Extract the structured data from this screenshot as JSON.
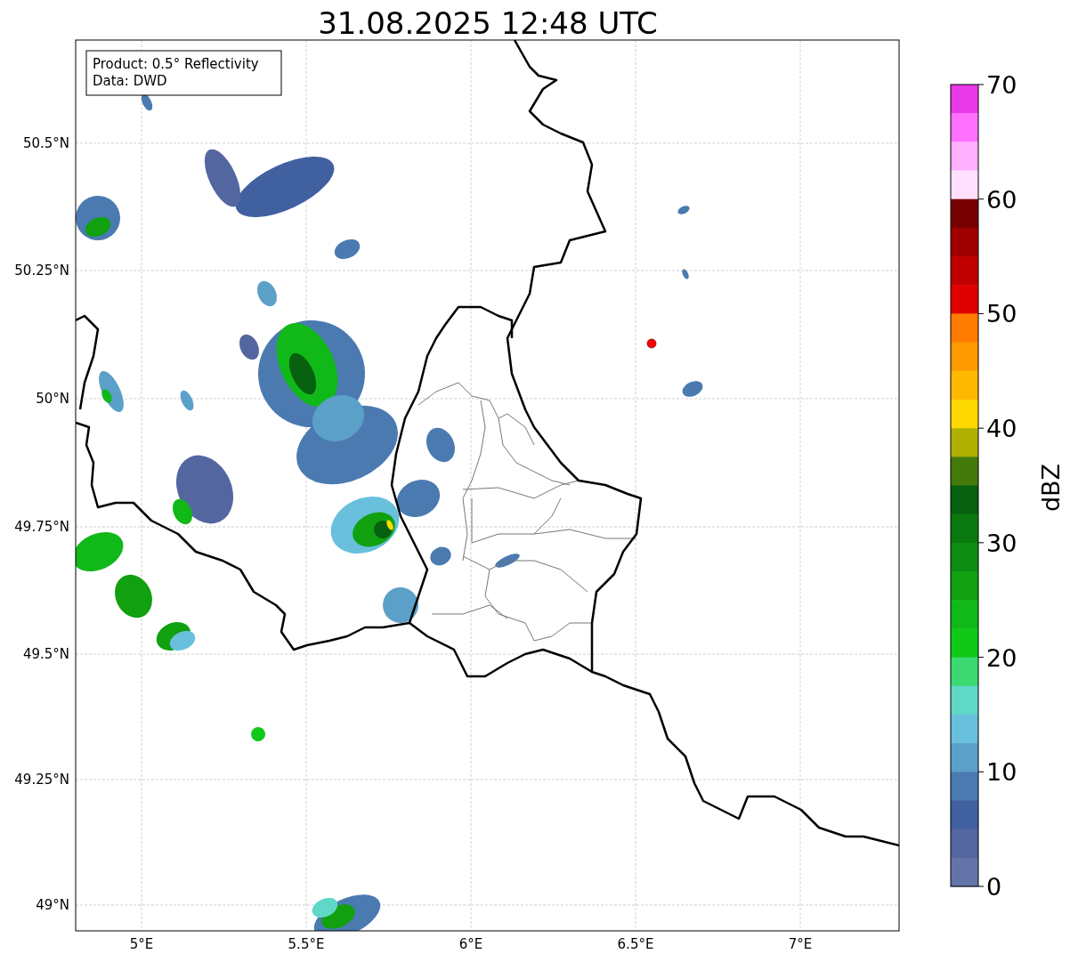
{
  "title": "31.08.2025 12:48 UTC",
  "info_box": {
    "lines": [
      "Product: 0.5° Reflectivity",
      "Data: DWD"
    ]
  },
  "x_ticks": [
    "5°E",
    "5.5°E",
    "6°E",
    "6.5°E",
    "7°E"
  ],
  "y_ticks": [
    "50.5°N",
    "50.25°N",
    "50°N",
    "49.75°N",
    "49.5°N",
    "49.25°N",
    "49°N"
  ],
  "colorbar": {
    "label": "dBZ",
    "ticks": [
      "70",
      "60",
      "50",
      "40",
      "30",
      "20",
      "10",
      "0"
    ],
    "segments": [
      {
        "color": "#e838e8"
      },
      {
        "color": "#ff70ff"
      },
      {
        "color": "#ffb0ff"
      },
      {
        "color": "#ffe0ff"
      },
      {
        "color": "#780000"
      },
      {
        "color": "#a00000"
      },
      {
        "color": "#c00000"
      },
      {
        "color": "#e00000"
      },
      {
        "color": "#ff7c00"
      },
      {
        "color": "#ff9a00"
      },
      {
        "color": "#ffb800"
      },
      {
        "color": "#ffd800"
      },
      {
        "color": "#b0b000"
      },
      {
        "color": "#447a0c"
      },
      {
        "color": "#066010"
      },
      {
        "color": "#0a7a10"
      },
      {
        "color": "#0c8c10"
      },
      {
        "color": "#10a010"
      },
      {
        "color": "#10b818"
      },
      {
        "color": "#10c818"
      },
      {
        "color": "#3cd870"
      },
      {
        "color": "#60d8c8"
      },
      {
        "color": "#68c0dc"
      },
      {
        "color": "#5aa0c8"
      },
      {
        "color": "#4a7ab0"
      },
      {
        "color": "#4060a0"
      },
      {
        "color": "#5466a0"
      },
      {
        "color": "#6474a8"
      }
    ]
  }
}
